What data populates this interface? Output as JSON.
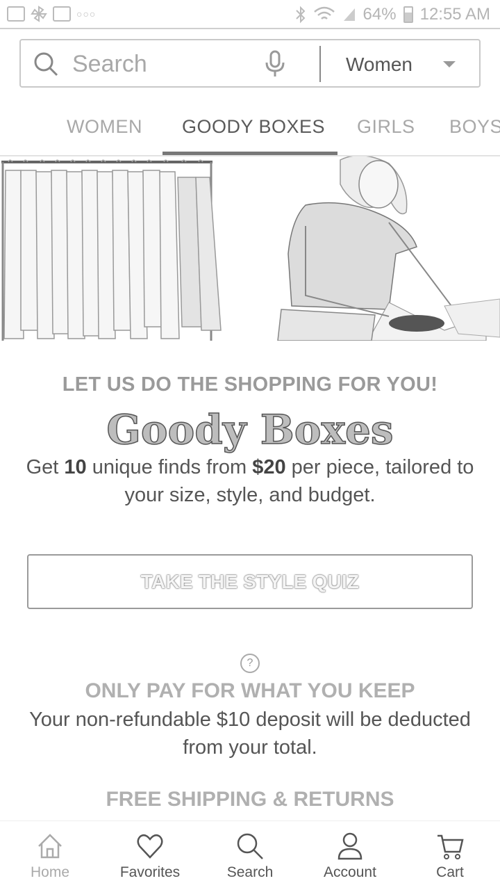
{
  "status_bar": {
    "battery": "64%",
    "time": "12:55 AM",
    "icons": [
      "image-icon",
      "pinwheel-icon",
      "gmail-icon",
      "more-dots-icon",
      "bluetooth-icon",
      "wifi-icon",
      "signal-icon",
      "battery-icon"
    ]
  },
  "search": {
    "placeholder": "Search",
    "department": "Women"
  },
  "tabs": [
    {
      "label": "WOMEN",
      "active": false
    },
    {
      "label": "GOODY BOXES",
      "active": true
    },
    {
      "label": "GIRLS",
      "active": false
    },
    {
      "label": "BOYS",
      "active": false
    }
  ],
  "promo": {
    "tagline": "LET US DO THE SHOPPING FOR YOU!",
    "brand": "Goody Boxes",
    "desc_1": "Get ",
    "desc_count": "10",
    "desc_2": " unique finds from ",
    "desc_price": "$20",
    "desc_3": " per piece, tailored to your size, style, and budget.",
    "cta": "TAKE THE STYLE QUIZ"
  },
  "info": {
    "help_glyph": "?",
    "pay_title": "ONLY PAY FOR WHAT YOU KEEP",
    "pay_text": "Your non-refundable $10 deposit will be deducted from your total.",
    "shipping_title": "FREE SHIPPING & RETURNS"
  },
  "bottom_nav": [
    {
      "label": "Home",
      "icon": "home-icon",
      "current": true
    },
    {
      "label": "Favorites",
      "icon": "heart-icon",
      "current": false
    },
    {
      "label": "Search",
      "icon": "search-icon",
      "current": false
    },
    {
      "label": "Account",
      "icon": "person-icon",
      "current": false
    },
    {
      "label": "Cart",
      "icon": "cart-icon",
      "current": false
    }
  ]
}
